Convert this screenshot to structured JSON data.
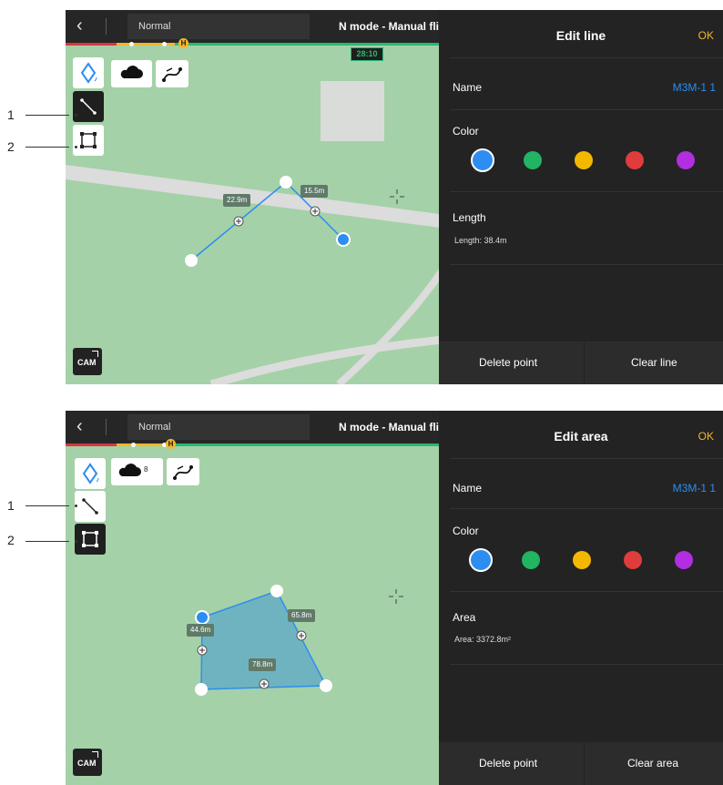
{
  "colors": {
    "map_green": "#a5d1a8",
    "road": "#dcdcdc",
    "panel_bg": "#232323",
    "accent_blue": "#2d8df0",
    "ok_yellow": "#f3b72c",
    "timer_green": "#2ab874"
  },
  "screens": [
    {
      "topbar": {
        "back_icon": "chevron-left-icon",
        "mode": "Normal",
        "flight_mode": "N mode - Manual flight",
        "timer": "28:10",
        "home_badge": "H"
      },
      "toolbar": {
        "tools": [
          "pin-tool-icon",
          "line-tool-icon",
          "area-tool-icon"
        ],
        "active_tool": "line",
        "chips": [
          "cloud-icon",
          "route-icon"
        ]
      },
      "segment_labels": [
        "22.9m",
        "15.5m"
      ],
      "cam_label": "CAM",
      "panel": {
        "title": "Edit line",
        "ok": "OK",
        "name_label": "Name",
        "name_value": "M3M-1 1",
        "color_label": "Color",
        "swatches": [
          "#2d8df0",
          "#20b463",
          "#f5b800",
          "#e03c3c",
          "#b12fe0"
        ],
        "selected_swatch": 0,
        "metric_label": "Length",
        "metric_value": "Length: 38.4m",
        "footer_left": "Delete point",
        "footer_right": "Clear line"
      },
      "callouts": [
        "1",
        "2"
      ]
    },
    {
      "topbar": {
        "back_icon": "chevron-left-icon",
        "mode": "Normal",
        "flight_mode": "N mode - Manual flight",
        "home_badge": "H"
      },
      "toolbar": {
        "tools": [
          "pin-tool-icon",
          "line-tool-icon",
          "area-tool-icon"
        ],
        "active_tool": "area",
        "chips": [
          "cloud-icon",
          "route-icon"
        ],
        "chip_count": "8"
      },
      "segment_labels": [
        "44.6m",
        "65.8m",
        "78.8m"
      ],
      "cam_label": "CAM",
      "panel": {
        "title": "Edit area",
        "ok": "OK",
        "name_label": "Name",
        "name_value": "M3M-1 1",
        "color_label": "Color",
        "swatches": [
          "#2d8df0",
          "#20b463",
          "#f5b800",
          "#e03c3c",
          "#b12fe0"
        ],
        "selected_swatch": 0,
        "metric_label": "Area",
        "metric_value": "Area: 3372.8m²",
        "footer_left": "Delete point",
        "footer_right": "Clear area"
      },
      "callouts": [
        "1",
        "2"
      ]
    }
  ]
}
